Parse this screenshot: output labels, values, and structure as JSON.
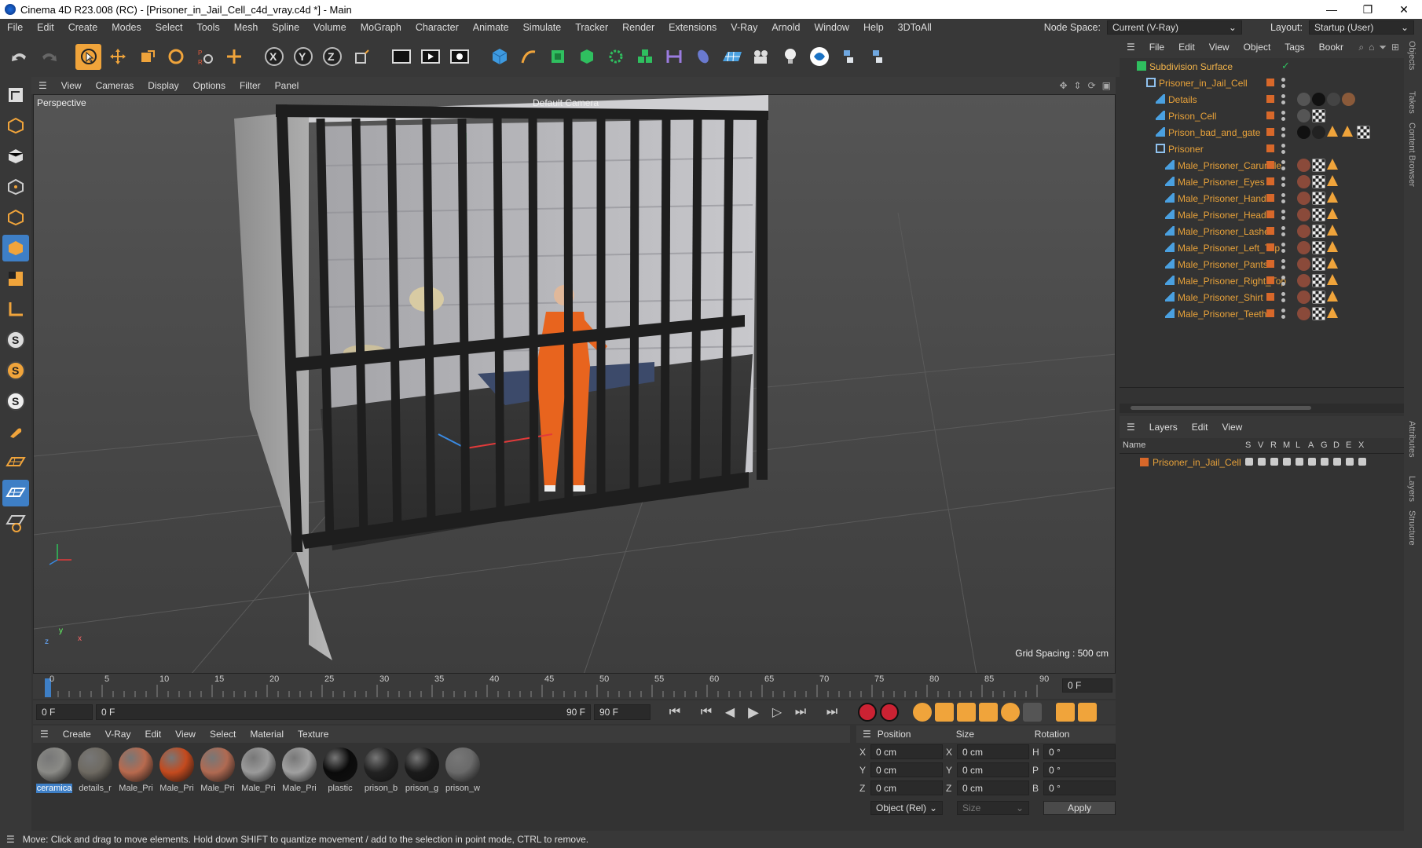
{
  "titlebar": {
    "title": "Cinema 4D R23.008 (RC) - [Prisoner_in_Jail_Cell_c4d_vray.c4d *] - Main",
    "minimize": "—",
    "maximize": "❐",
    "close": "✕"
  },
  "menubar": {
    "items": [
      "File",
      "Edit",
      "Create",
      "Modes",
      "Select",
      "Tools",
      "Mesh",
      "Spline",
      "Volume",
      "MoGraph",
      "Character",
      "Animate",
      "Simulate",
      "Tracker",
      "Render",
      "Extensions",
      "V-Ray",
      "Arnold",
      "Window",
      "Help",
      "3DToAll"
    ],
    "node_space_label": "Node Space:",
    "node_space_value": "Current (V-Ray)",
    "layout_label": "Layout:",
    "layout_value": "Startup (User)"
  },
  "viewport": {
    "menu": [
      "View",
      "Cameras",
      "Display",
      "Options",
      "Filter",
      "Panel"
    ],
    "perspective_label": "Perspective",
    "camera_label": "Default Camera",
    "grid_spacing": "Grid Spacing : 500 cm",
    "axis_y": "y",
    "axis_x": "x",
    "axis_z": "z"
  },
  "timeline": {
    "ticks": [
      "0",
      "5",
      "10",
      "15",
      "20",
      "25",
      "30",
      "35",
      "40",
      "45",
      "50",
      "55",
      "60",
      "65",
      "70",
      "75",
      "80",
      "85",
      "90"
    ],
    "current_frame": "0 F"
  },
  "transport": {
    "start_frame": "0 F",
    "range_start": "0 F",
    "range_end": "90 F",
    "end_frame": "90 F"
  },
  "materials": {
    "menu": [
      "Create",
      "V-Ray",
      "Edit",
      "View",
      "Select",
      "Material",
      "Texture"
    ],
    "items": [
      {
        "label": "ceramica",
        "color": "#8a8a86"
      },
      {
        "label": "details_r",
        "color": "#6e6a62"
      },
      {
        "label": "Male_Pri",
        "color": "#b86a4e"
      },
      {
        "label": "Male_Pri",
        "color": "#c44a1e"
      },
      {
        "label": "Male_Pri",
        "color": "#b06a52"
      },
      {
        "label": "Male_Pri",
        "color": "#9a9a9a"
      },
      {
        "label": "Male_Pri",
        "color": "#a0a0a0"
      },
      {
        "label": "plastic",
        "color": "#0a0a0a"
      },
      {
        "label": "prison_b",
        "color": "#222222"
      },
      {
        "label": "prison_g",
        "color": "#1a1a1a"
      },
      {
        "label": "prison_w",
        "color": "#6a6a6a"
      }
    ]
  },
  "attributes": {
    "headers": [
      "Position",
      "Size",
      "Rotation"
    ],
    "rows": [
      {
        "axis": "X",
        "pos": "0 cm",
        "size_axis": "X",
        "size": "0 cm",
        "rot_axis": "H",
        "rot": "0 °"
      },
      {
        "axis": "Y",
        "pos": "0 cm",
        "size_axis": "Y",
        "size": "0 cm",
        "rot_axis": "P",
        "rot": "0 °"
      },
      {
        "axis": "Z",
        "pos": "0 cm",
        "size_axis": "Z",
        "size": "0 cm",
        "rot_axis": "B",
        "rot": "0 °"
      }
    ],
    "coord_mode": "Object (Rel)",
    "size_mode": "Size",
    "apply": "Apply"
  },
  "status": {
    "text": "Move: Click and drag to move elements. Hold down SHIFT to quantize movement / add to the selection in point mode, CTRL to remove."
  },
  "objects": {
    "menu": [
      "File",
      "Edit",
      "View",
      "Object",
      "Tags",
      "Bookr"
    ],
    "items": [
      {
        "name": "Subdivision Surface",
        "indent": 0,
        "type": "subd"
      },
      {
        "name": "Prisoner_in_Jail_Cell",
        "indent": 1,
        "type": "null"
      },
      {
        "name": "Details",
        "indent": 2,
        "type": "poly"
      },
      {
        "name": "Prison_Cell",
        "indent": 2,
        "type": "poly"
      },
      {
        "name": "Prison_bad_and_gate",
        "indent": 2,
        "type": "poly"
      },
      {
        "name": "Prisoner",
        "indent": 2,
        "type": "null"
      },
      {
        "name": "Male_Prisoner_Caruncle",
        "indent": 3,
        "type": "poly"
      },
      {
        "name": "Male_Prisoner_Eyes",
        "indent": 3,
        "type": "poly"
      },
      {
        "name": "Male_Prisoner_Hands",
        "indent": 3,
        "type": "poly"
      },
      {
        "name": "Male_Prisoner_Head",
        "indent": 3,
        "type": "poly"
      },
      {
        "name": "Male_Prisoner_Lashes",
        "indent": 3,
        "type": "poly"
      },
      {
        "name": "Male_Prisoner_Left_Top",
        "indent": 3,
        "type": "poly"
      },
      {
        "name": "Male_Prisoner_Pants",
        "indent": 3,
        "type": "poly"
      },
      {
        "name": "Male_Prisoner_Right_Top",
        "indent": 3,
        "type": "poly"
      },
      {
        "name": "Male_Prisoner_Shirt",
        "indent": 3,
        "type": "poly"
      },
      {
        "name": "Male_Prisoner_Teeth",
        "indent": 3,
        "type": "poly"
      }
    ]
  },
  "layers": {
    "menu": [
      "Layers",
      "Edit",
      "View"
    ],
    "columns": [
      "Name",
      "S",
      "V",
      "R",
      "M",
      "L",
      "A",
      "G",
      "D",
      "E",
      "X"
    ],
    "items": [
      {
        "name": "Prisoner_in_Jail_Cell",
        "color": "#d8682a"
      }
    ]
  },
  "sidetabs": [
    "Objects",
    "Takes",
    "Content Browser",
    "Attributes",
    "Layers",
    "Structure"
  ]
}
